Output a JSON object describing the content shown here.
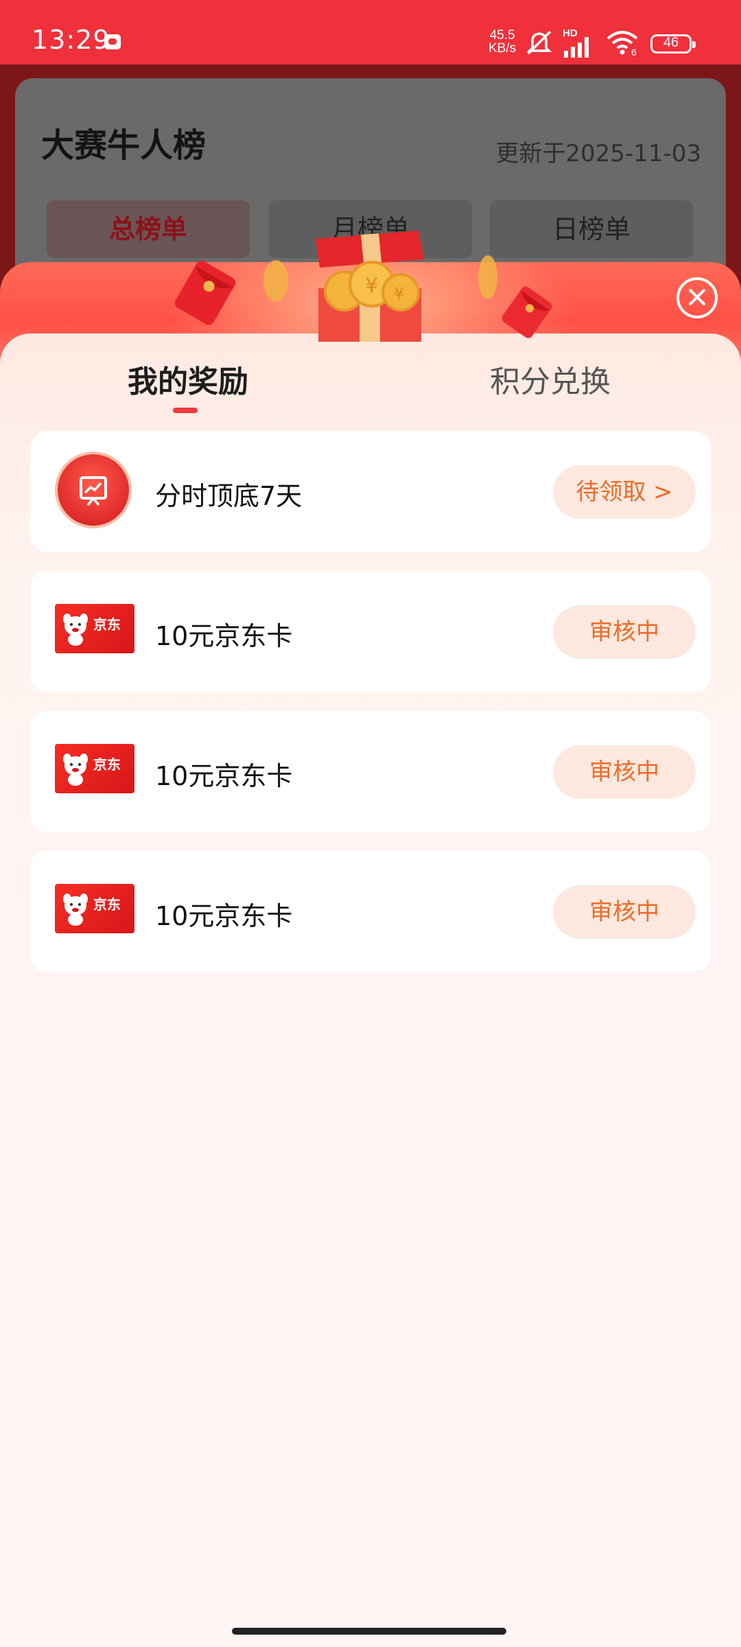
{
  "status_bar": {
    "time": "13:29",
    "net_speed_value": "45.5",
    "net_speed_unit": "KB/s",
    "signal_label": "HD",
    "wifi_sub": "6",
    "battery": "46"
  },
  "background_page": {
    "title": "大赛牛人榜",
    "updated": "更新于2025-11-03",
    "tabs": [
      "总榜单",
      "月榜单",
      "日榜单"
    ]
  },
  "sheet": {
    "tabs": [
      "我的奖励",
      "积分兑换"
    ],
    "rewards": [
      {
        "icon": "chart-icon",
        "name": "分时顶底7天",
        "action": "待领取 >"
      },
      {
        "icon": "jd-card-icon",
        "name": "10元京东卡",
        "action": "审核中"
      },
      {
        "icon": "jd-card-icon",
        "name": "10元京东卡",
        "action": "审核中"
      },
      {
        "icon": "jd-card-icon",
        "name": "10元京东卡",
        "action": "审核中"
      }
    ],
    "jd_logo_text": "京东"
  },
  "colors": {
    "status_bar": "#f0303a",
    "accent_red": "#ef3a3f",
    "action_orange": "#ef6b28",
    "action_bg": "#fde8df"
  }
}
